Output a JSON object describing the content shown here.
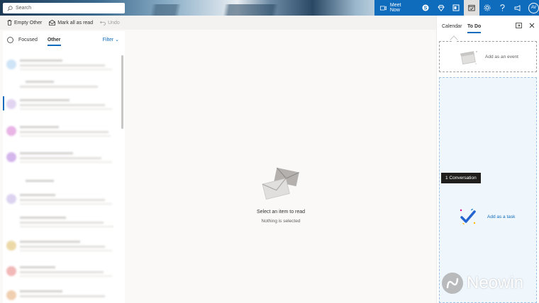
{
  "header": {
    "search_placeholder": "Search",
    "meet_now": "Meet Now",
    "avatar_initials": "AV"
  },
  "commands": {
    "empty": "Empty Other",
    "mark_read": "Mark all as read",
    "undo": "Undo"
  },
  "mail_list": {
    "tabs": [
      "Focused",
      "Other"
    ],
    "active_tab": "Other",
    "filter": "Filter"
  },
  "reading_pane": {
    "title": "Select an item to read",
    "subtitle": "Nothing is selected"
  },
  "side_pane": {
    "tabs": [
      "Calendar",
      "To Do"
    ],
    "active_tab": "To Do",
    "add_event": "Add as an event",
    "tooltip": "1 Conversation",
    "add_task": "Add as a task"
  },
  "watermark": {
    "text": "Neowin"
  },
  "colors": {
    "accent": "#0f6cbd",
    "todo_bg": "#eff6fc"
  }
}
